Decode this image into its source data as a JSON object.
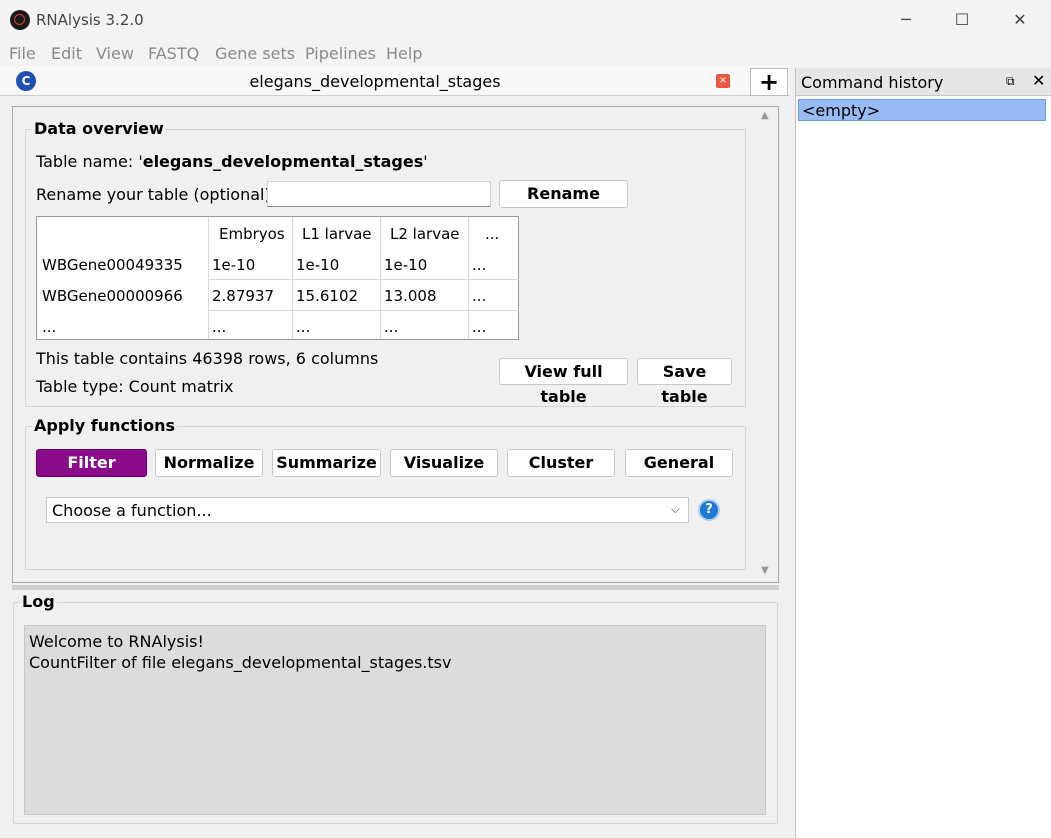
{
  "window": {
    "title": "RNAlysis 3.2.0",
    "minimize": "─",
    "maximize": "☐",
    "close": "✕"
  },
  "menu": [
    "File",
    "Edit",
    "View",
    "FASTQ",
    "Gene sets",
    "Pipelines",
    "Help"
  ],
  "tab": {
    "badge": "C",
    "title": "elegans_developmental_stages",
    "close": "×",
    "add": "+"
  },
  "overview": {
    "title": "Data overview",
    "name_label": "Table name: '",
    "name_value": "elegans_developmental_stages",
    "name_end": "'",
    "rename_label": "Rename your table (optional):",
    "rename_value": "",
    "rename_button": "Rename",
    "rows_info": "This table contains 46398 rows, 6 columns",
    "type_info": "Table type: Count matrix",
    "view_button": "View full table",
    "save_button": "Save table"
  },
  "table": {
    "headers": [
      "",
      "Embryos",
      "L1 larvae",
      "L2 larvae",
      "..."
    ],
    "rows": [
      [
        "WBGene00049335",
        "1e-10",
        "1e-10",
        "1e-10",
        "..."
      ],
      [
        "WBGene00000966",
        "2.87937",
        "15.6102",
        "13.008",
        "..."
      ],
      [
        "...",
        "...",
        "...",
        "...",
        "..."
      ]
    ]
  },
  "functions": {
    "title": "Apply functions",
    "tabs": [
      "Filter",
      "Normalize",
      "Summarize",
      "Visualize",
      "Cluster",
      "General"
    ],
    "combo_value": "Choose a function...",
    "help": "?"
  },
  "log": {
    "title": "Log",
    "lines": [
      "Welcome to RNAlysis!",
      "CountFilter of file elegans_developmental_stages.tsv"
    ]
  },
  "history": {
    "title": "Command history",
    "item": "<empty>"
  },
  "colors": {
    "accent": "#8a0b89",
    "selection": "#99bbf5",
    "help": "#1f7ad6"
  }
}
